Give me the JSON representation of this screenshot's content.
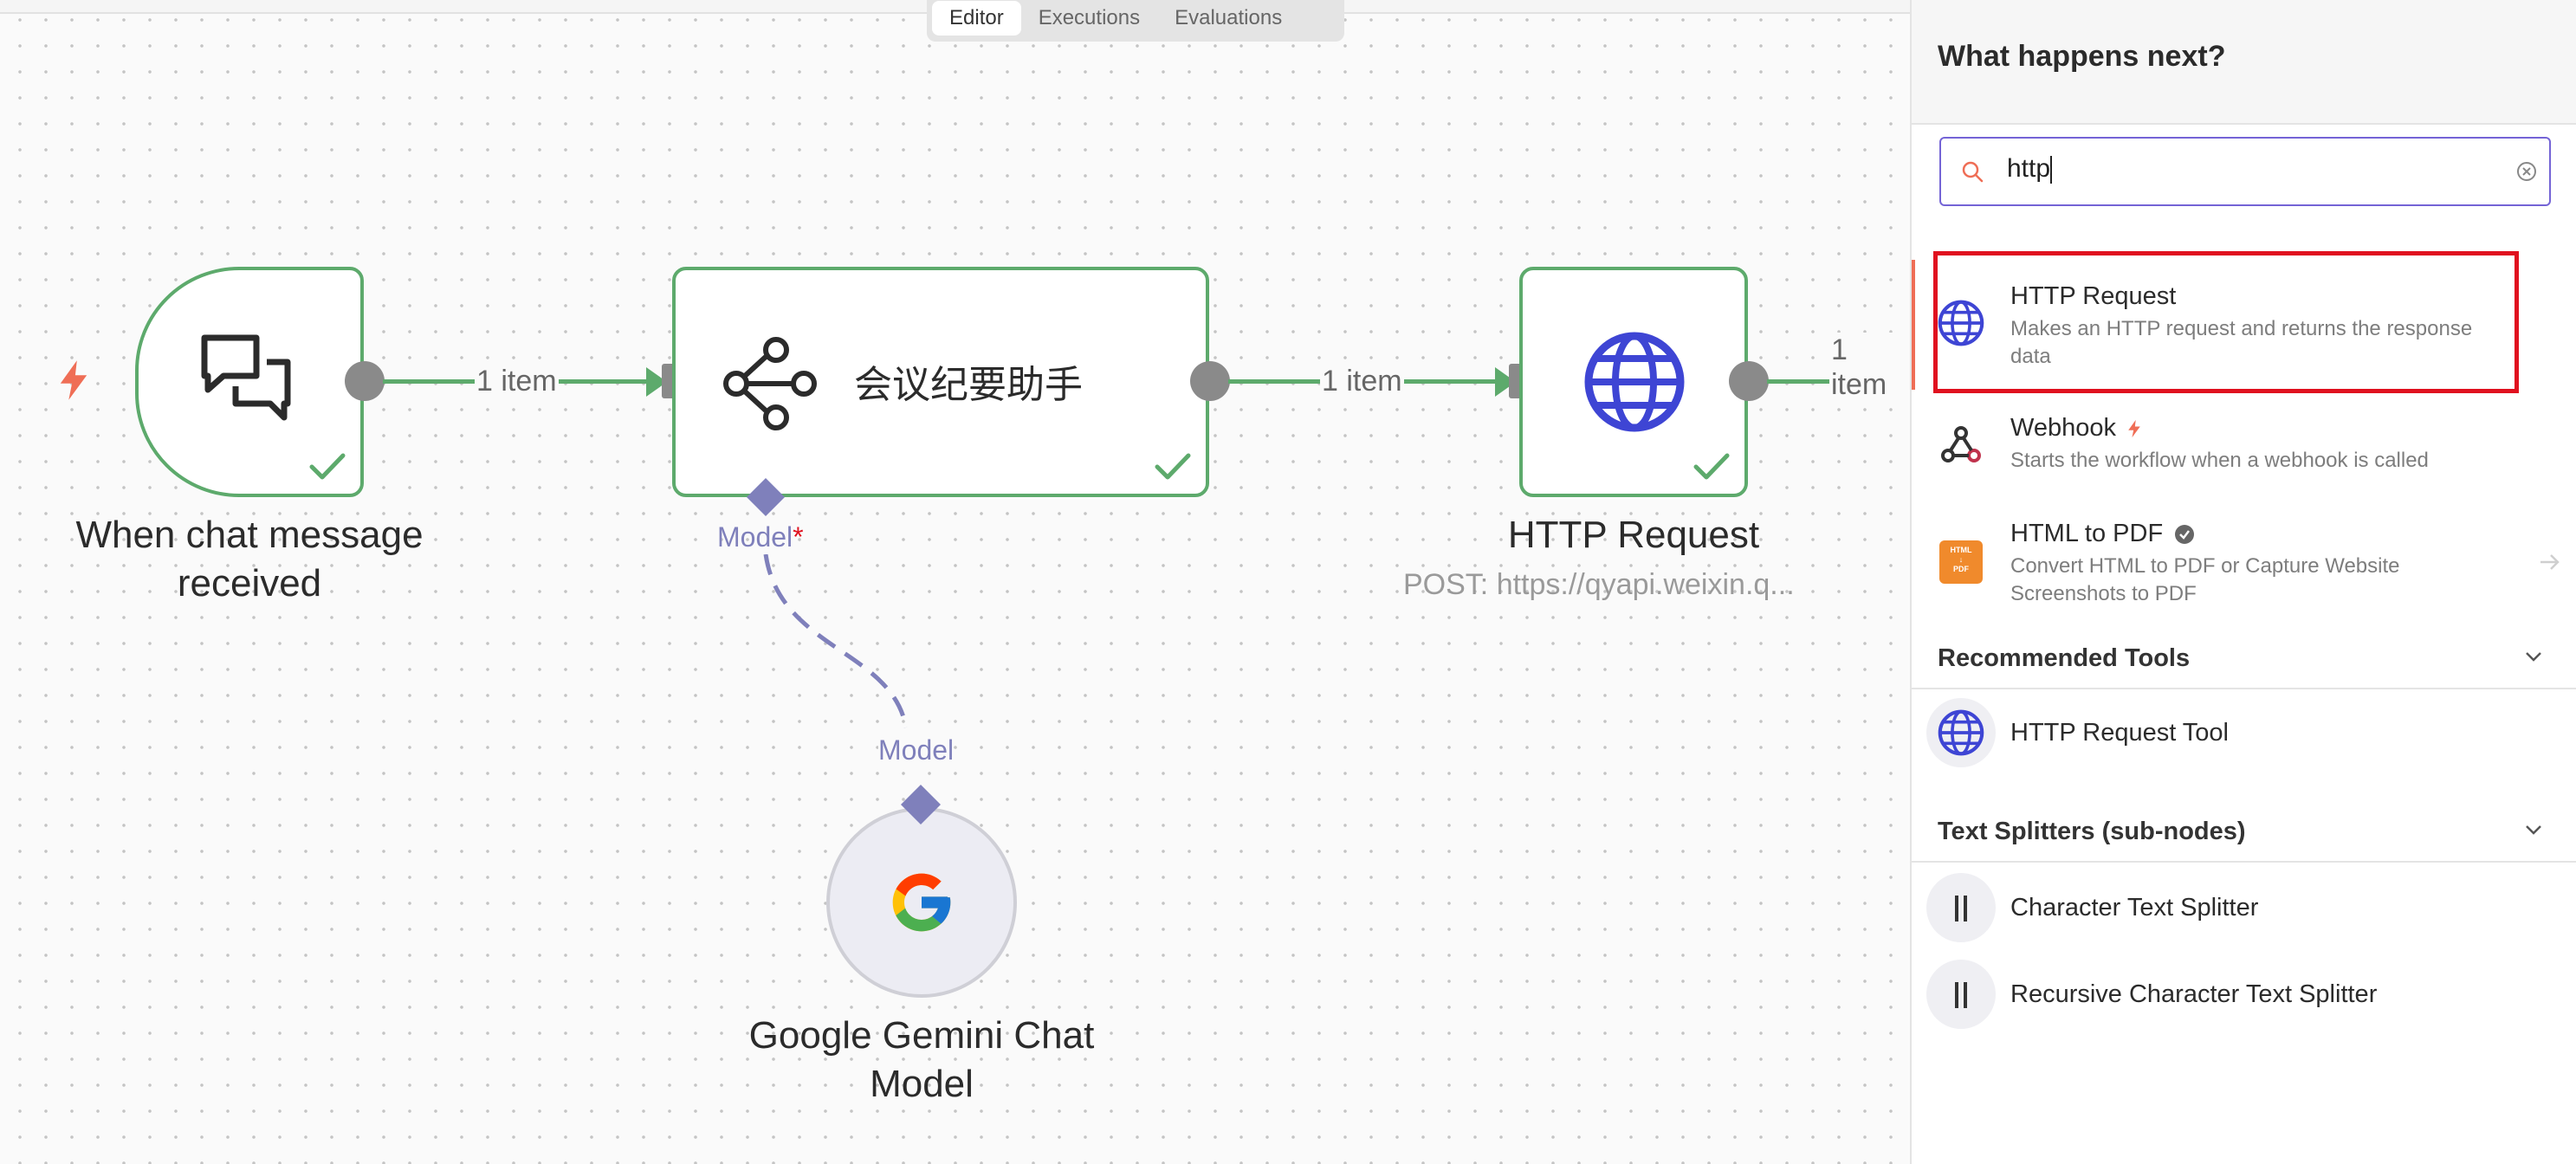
{
  "view_tabs": [
    "Editor",
    "Executions",
    "Evaluations"
  ],
  "nodes": {
    "trigger": {
      "title_line1": "When chat message",
      "title_line2": "received"
    },
    "agent": {
      "title": "会议纪要助手"
    },
    "http": {
      "title": "HTTP Request",
      "subtitle": "POST: https://qyapi.weixin.q..."
    },
    "gemini": {
      "title_line1": "Google Gemini Chat",
      "title_line2": "Model"
    }
  },
  "connections": {
    "c1_label": "1 item",
    "c2_label": "1 item",
    "c3_label": "1 item",
    "model_in_label": "Model",
    "model_required": "*",
    "model_out_label": "Model"
  },
  "panel": {
    "title": "What happens next?",
    "search_value": "http",
    "results": [
      {
        "title": "HTTP Request",
        "desc_line1": "Makes an HTTP request and returns the response",
        "desc_line2": "data"
      },
      {
        "title": "Webhook",
        "desc_line1": "Starts the workflow when a webhook is called"
      },
      {
        "title": "HTML to PDF",
        "desc_line1": "Convert HTML to PDF or Capture Website",
        "desc_line2": "Screenshots to PDF",
        "icon_text": [
          "HTML",
          "↓",
          "PDF"
        ]
      }
    ],
    "sections": [
      {
        "title": "Recommended Tools",
        "items": [
          "HTTP Request Tool"
        ]
      },
      {
        "title": "Text Splitters (sub-nodes)",
        "items": [
          "Character Text Splitter",
          "Recursive Character Text Splitter"
        ]
      }
    ]
  },
  "colors": {
    "success_green": "#5daa6c",
    "ai_purple": "#7f80bb",
    "accent_purple": "#7464d6",
    "highlight_red": "#e0111f",
    "globe_blue": "#3e45d4",
    "trigger_orange": "#ef6e56"
  }
}
